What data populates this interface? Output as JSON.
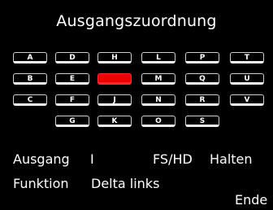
{
  "title": "Ausgangszuordnung",
  "keys": [
    "A",
    "B",
    "C",
    "D",
    "E",
    "F",
    "G",
    "H",
    "",
    "J",
    "K",
    "L",
    "M",
    "N",
    "O",
    "P",
    "Q",
    "R",
    "S",
    "T",
    "U",
    "V"
  ],
  "selected_key_color": "#ee0000",
  "info": {
    "ausgang_label": "Ausgang",
    "ausgang_value": "I",
    "mode": "FS/HD",
    "hold": "Halten",
    "funktion_label": "Funktion",
    "funktion_value": "Delta links",
    "end": "Ende"
  }
}
